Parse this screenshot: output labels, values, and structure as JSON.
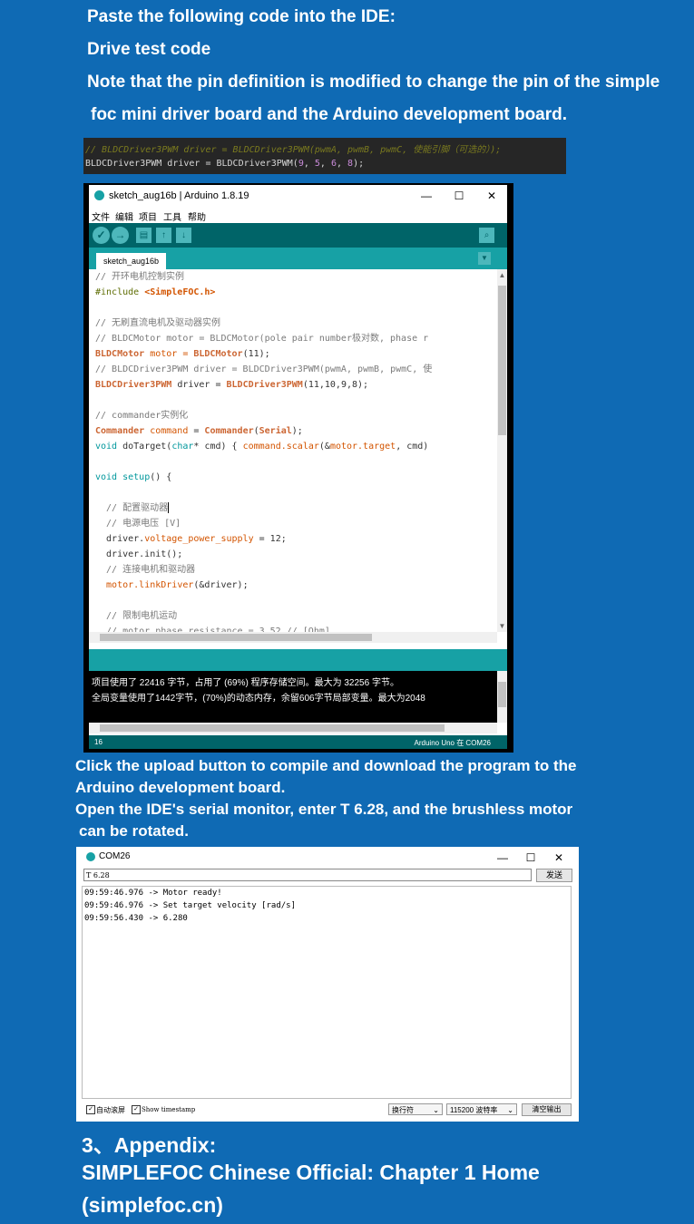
{
  "intro": {
    "line1": "Paste the following code into the IDE:",
    "line2": "Drive test code",
    "line3": "Note that the pin definition is modified to change the pin of the simple",
    "line4": "foc mini driver board and the Arduino development board."
  },
  "snippet": {
    "comment": "// BLDCDriver3PWM driver = BLDCDriver3PWM(pwmA, pwmB, pwmC, 使能引脚（可选的）);",
    "code_prefix": "BLDCDriver3PWM driver = BLDCDriver3PWM(",
    "args": [
      "9",
      "5",
      "6",
      "8"
    ],
    "code_suffix": ");"
  },
  "ide": {
    "window_title": "sketch_aug16b | Arduino 1.8.19",
    "menu": [
      "文件",
      "编辑",
      "项目",
      "工具",
      "帮助"
    ],
    "tab_label": "sketch_aug16b",
    "code": {
      "l1": "// 开环电机控制实例",
      "l2a": "#include ",
      "l2b": "<SimpleFOC.h>",
      "l4": "// 无刷直流电机及驱动器实例",
      "l5": "// BLDCMotor motor = BLDCMotor(pole pair number极对数, phase r",
      "l6a": "BLDCMotor",
      "l6b": " motor = ",
      "l6c": "BLDCMotor",
      "l6d": "(11);",
      "l7": "// BLDCDriver3PWM driver = BLDCDriver3PWM(pwmA, pwmB, pwmC, 使",
      "l8a": "BLDCDriver3PWM",
      "l8b": " driver = ",
      "l8c": "BLDCDriver3PWM",
      "l8d": "(11,10,9,8);",
      "l10": "// commander实例化",
      "l11a": "Commander",
      "l11b": " command",
      "l11c": " = ",
      "l11d": "Commander",
      "l11e": "(",
      "l11f": "Serial",
      "l11g": ");",
      "l12a": "void",
      "l12b": " doTarget(",
      "l12c": "char",
      "l12d": "* cmd) { ",
      "l12e": "command.scalar",
      "l12f": "(&",
      "l12g": "motor.target",
      "l12h": ", cmd)",
      "l14a": "void",
      "l14b": " ",
      "l14c": "setup",
      "l14d": "() {",
      "l16": "  // 配置驱动器",
      "l17": "  // 电源电压 [V]",
      "l18a": "  driver.",
      "l18b": "voltage_power_supply",
      "l18c": " = 12;",
      "l19": "  driver.init();",
      "l20": "  // 连接电机和驱动器",
      "l21a": "  motor.",
      "l21b": "linkDriver",
      "l21c": "(&driver);",
      "l23": "  // 限制电机运动",
      "l24": "  // motor.phase_resistance = 3.52 // [Ohm]"
    },
    "console": {
      "line1": "项目使用了 22416 字节，占用了 (69%) 程序存储空间。最大为 32256 字节。",
      "line2": "全局变量使用了1442字节，(70%)的动态内存，余留606字节局部变量。最大为2048"
    },
    "status_line": "16",
    "status_board": "Arduino Uno 在 COM26"
  },
  "middle": {
    "line1": "Click the upload button to compile and download the program to the",
    "line2": "Arduino development board.",
    "line3": "Open the IDE's serial monitor, enter T 6.28, and the brushless motor",
    "line4": "can be rotated."
  },
  "serial": {
    "window_title": "COM26",
    "input_value": "T 6.28",
    "send_label": "发送",
    "output": [
      "09:59:46.976 -> Motor ready!",
      "09:59:46.976 -> Set target velocity [rad/s]",
      "09:59:56.430 -> 6.280"
    ],
    "autoscroll_label": "自动滚屏",
    "timestamp_label": "Show timestamp",
    "line_ending": "换行符",
    "baud": "115200 波特率",
    "clear_label": "清空输出"
  },
  "appendix": {
    "heading": "3、Appendix:",
    "line1": "SIMPLEFOC Chinese Official: Chapter 1 Home",
    "line2": "(simplefoc.cn)"
  },
  "colors": {
    "background": "#0f6ab4",
    "arduino_dark": "#006468",
    "arduino_teal": "#17a1a5"
  }
}
